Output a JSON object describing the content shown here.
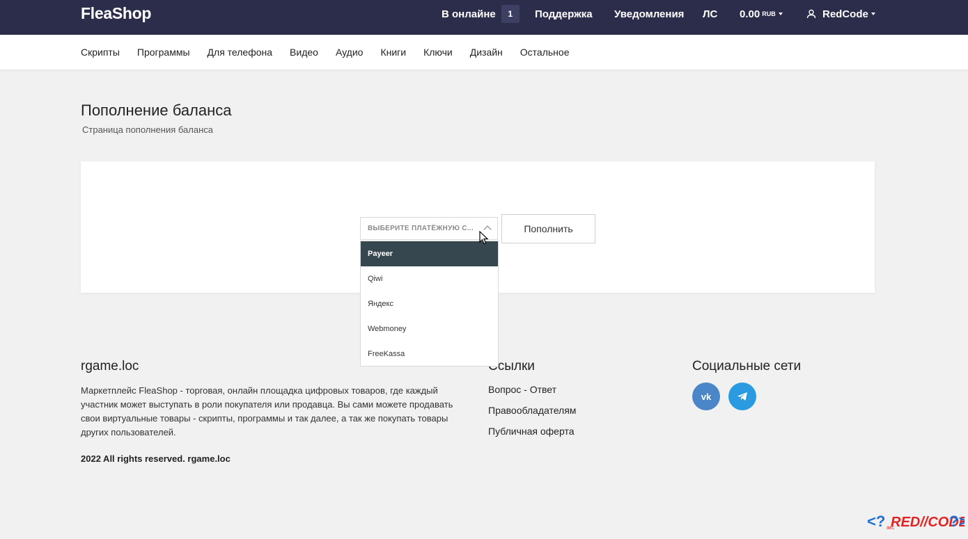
{
  "header": {
    "logo": "FleaShop",
    "online_label": "В онлайне",
    "online_count": "1",
    "support": "Поддержка",
    "notifications": "Уведомления",
    "messages": "ЛС",
    "balance": "0.00",
    "currency": "RUB",
    "username": "RedCode"
  },
  "categories": [
    "Скрипты",
    "Программы",
    "Для телефона",
    "Видео",
    "Аудио",
    "Книги",
    "Ключи",
    "Дизайн",
    "Остальное"
  ],
  "page": {
    "title": "Пополнение баланса",
    "subtitle": "Страница пополнения баланса"
  },
  "payment": {
    "select_placeholder": "ВЫБЕРИТЕ ПЛАТЁЖНУЮ С...",
    "options": [
      "Payeer",
      "Qiwi",
      "Яндекс",
      "Webmoney",
      "FreeKassa"
    ],
    "highlighted_option": "Payeer",
    "submit_label": "Пополнить"
  },
  "footer": {
    "about_title": "rgame.loc",
    "about_text": "Маркетплейс FleaShop - торговая, онлайн площадка цифровых товаров, где каждый участник может выступать в роли покупателя или продавца. Вы сами можете продавать свои виртуальные товары - скрипты, программы и так далее, а так же покупать товары других пользователей.",
    "copyright": "2022 All rights reserved. rgame.loc",
    "links_title": "Ссылки",
    "links": [
      "Вопрос - Ответ",
      "Правообладателям",
      "Публичная оферта"
    ],
    "social_title": "Социальные сети",
    "social_icons": [
      "vk-icon",
      "telegram-icon"
    ],
    "vk_glyph": "vk"
  },
  "watermark": {
    "main": "RED//CODE",
    "small": "arc"
  },
  "colors": {
    "header_bg": "#2b2d4b",
    "dropdown_active": "#37474f",
    "vk": "#4a86c8",
    "telegram": "#2a9be0",
    "watermark_blue": "#1e6fd6",
    "watermark_red": "#e02424"
  }
}
